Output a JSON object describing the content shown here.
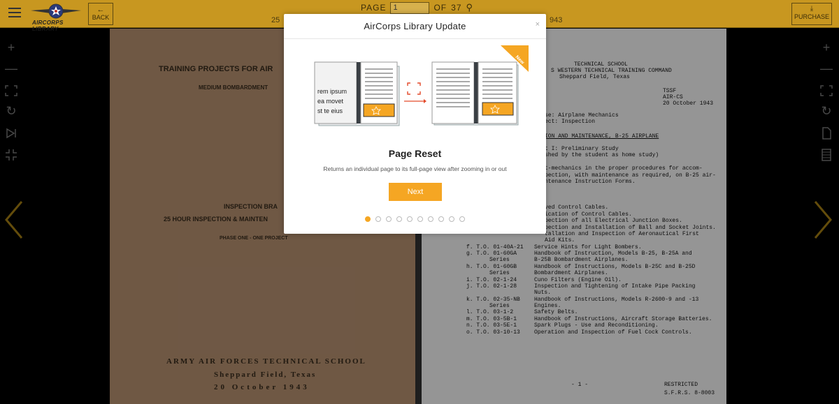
{
  "toolbar": {
    "logo_text": "AIRCORPS LIBRARY",
    "back_label": "BACK",
    "page_label": "PAGE",
    "page_value": "1",
    "of_label": "OF",
    "total_pages": "37",
    "purchase_label": "PURCHASE",
    "sub_left": "25",
    "sub_right": "943"
  },
  "left_page": {
    "title": "TRAINING PROJECTS FOR AIR",
    "subtitle": "MEDIUM BOMBARDMENT",
    "line1": "INSPECTION   BRA",
    "line2": "25 HOUR INSPECTION & MAINTEN",
    "line3": "PHASE ONE - ONE PROJECT",
    "footer1": "ARMY AIR FORCES TECHNICAL SCHOOL",
    "footer2": "Sheppard Field, Texas",
    "footer3": "20 October 1943"
  },
  "right_page": {
    "h1": "TECHNICAL SCHOOL",
    "h2": "S WESTERN TECHNICAL TRAINING COMMAND",
    "h3": "Sheppard Field, Texas",
    "code1": "TSSF",
    "code2": "AIR-CS",
    "date": "20 October 1943",
    "l1": "se:   Airplane Mechanics",
    "l2": "ect:  Inspection",
    "l3": "ION AND MAINTENANCE, B-25 AIRPLANE",
    "l4": "t I:  Preliminary Study",
    "l5": "shed by the student as home study)",
    "l6": "t-mechanics in the proper procedures for accom-",
    "l7": "pection, with maintenance as required, on B-25 air-",
    "l8": "ntenance Instruction Forms.",
    "l9": "ved Control Cables.",
    "l10": "ication of Control Cables.",
    "l11": "pection of all Electrical Junction Boxes.",
    "l12": "pection and Installation of Ball and Socket Joints.",
    "l13": "tallation and Inspection of Aeronautical First",
    "l14": "Aid Kits.",
    "f_ref": "f.  T.O. 01-40A-21",
    "f_txt": "Service Hints for Light Bombers.",
    "g_ref": "g.  T.O. 01-60GA",
    "g_txt": "Handbook of Instruction, Models B-25, B-25A and",
    "g_ser": "Series",
    "g_txt2": "B-25B Bombardment Airplanes.",
    "h_ref": "h.  T.O. 01-60GB",
    "h_txt": "Handbook of Instructions, Models B-25C and B-25D",
    "h_ser": "Series",
    "h_txt2": "Bombardment Airplanes.",
    "i_ref": "i.  T.O. 02-1-24",
    "i_txt": "Cuno Filters (Engine Oil).",
    "j_ref": "j.  T.O. 02-1-28",
    "j_txt": "Inspection and Tightening of Intake Pipe Packing",
    "j_txt2": "Nuts.",
    "k_ref": "k.  T.O. 02-35-NB",
    "k_txt": "Handbook of Instructions, Models R-2600-9 and -13",
    "k_ser": "Series",
    "k_txt2": "Engines.",
    "l_ref": "l.  T.O. 03-1-2",
    "l_txt": "Safety Belts.",
    "m_ref": "m.  T.O. 03-5B-1",
    "m_txt": "Handbook of Instructions, Aircraft Storage Batteries.",
    "n_ref": "n.  T.O. 03-5E-1",
    "n_txt": "Spark Plugs - Use and Reconditioning.",
    "o_ref": "o.  T.O. 03-10-13",
    "o_txt": "Operation and Inspection of Fuel Cock Controls.",
    "page_no": "- 1 -",
    "restricted": "RESTRICTED",
    "sfrs": "S.F.R.S. 8-8003"
  },
  "modal": {
    "header": "AirCorps Library Update",
    "close": "×",
    "illus_text": [
      "rem ipsum",
      "ea movet",
      "st te eius"
    ],
    "new_badge": "New",
    "title": "Page Reset",
    "description": "Returns an individual page to its full-page view after zooming in or out",
    "next_label": "Next",
    "dots_total": 10,
    "dots_active": 1
  },
  "colors": {
    "toolbar_bg": "#c89720",
    "accent": "#f5a623",
    "left_page": "#9a7a5f",
    "right_page": "#cfcfcf"
  }
}
